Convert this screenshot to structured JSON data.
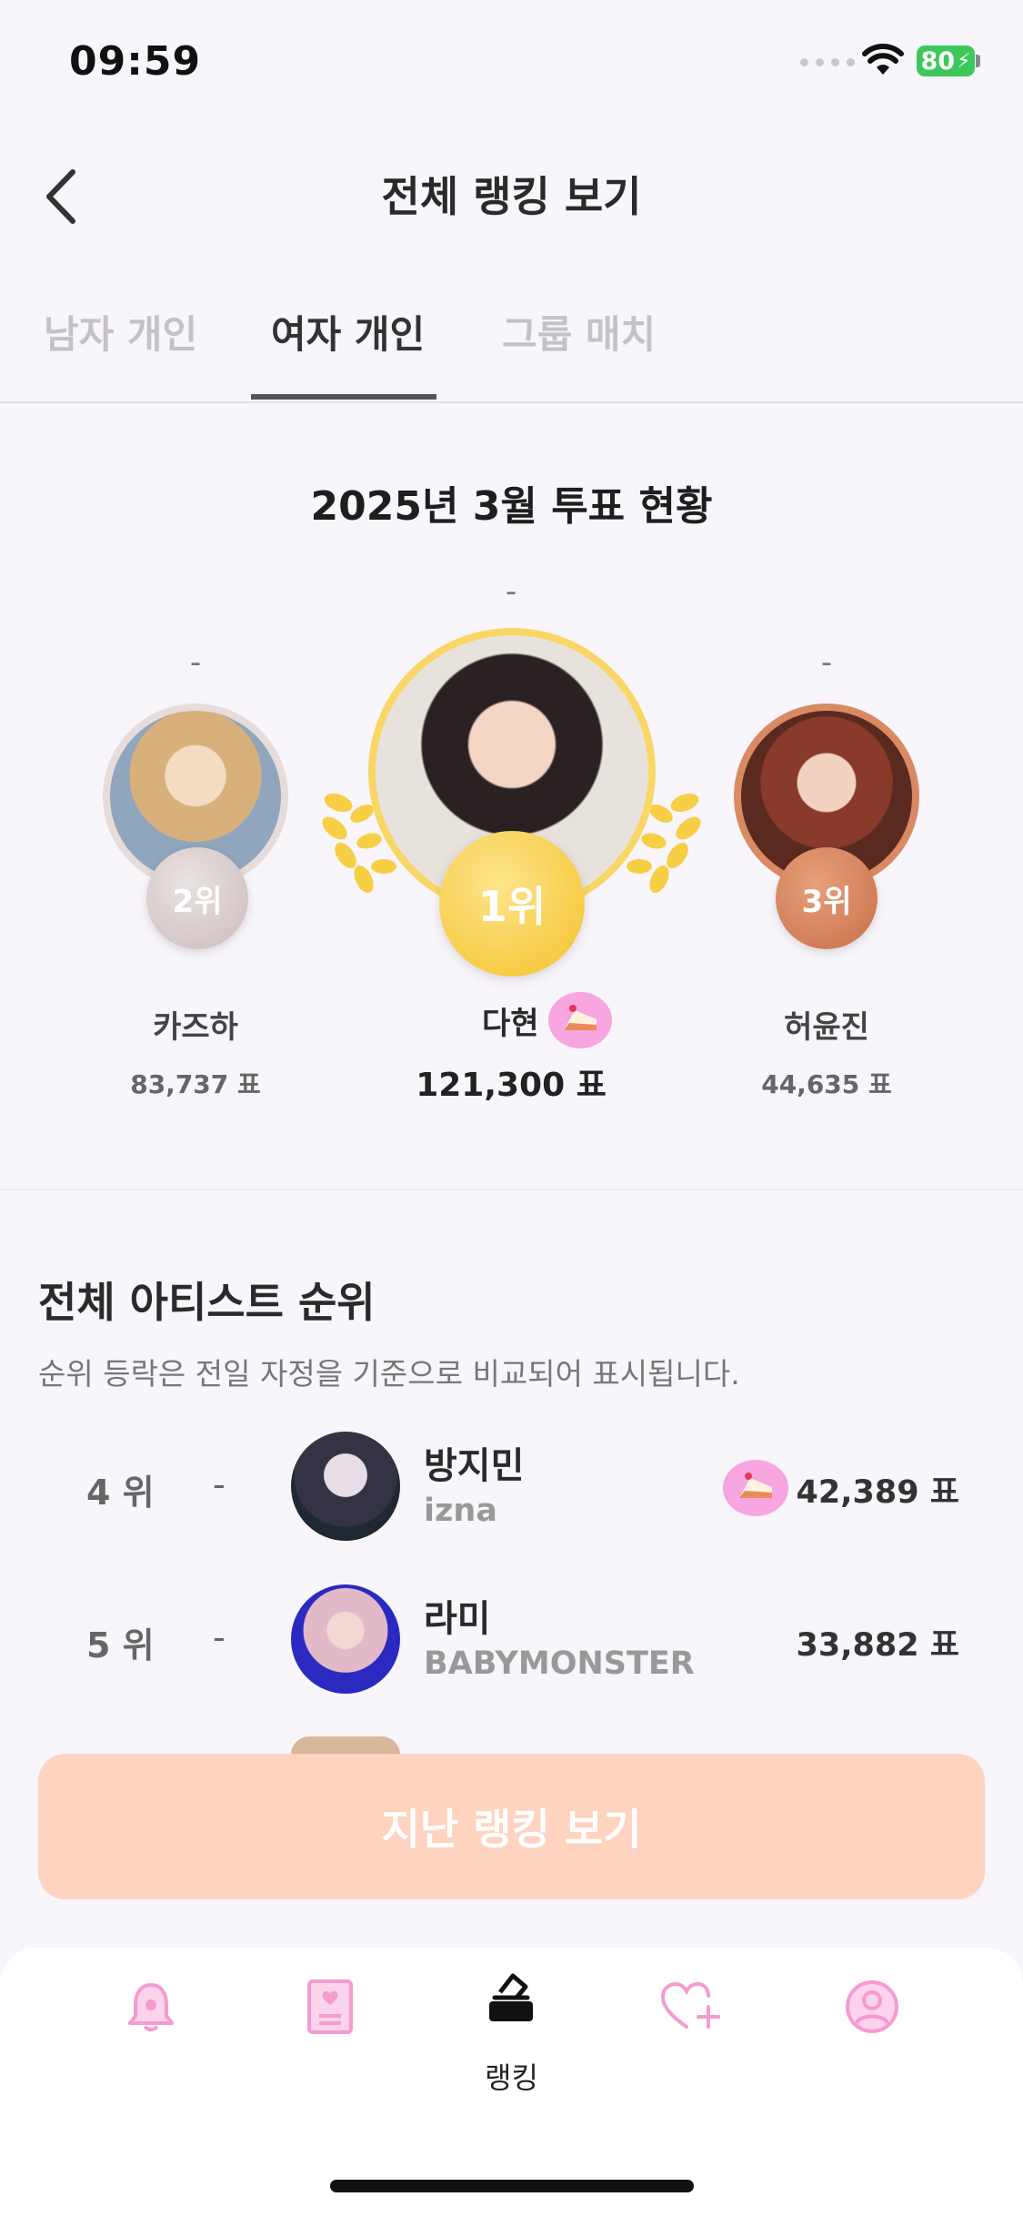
{
  "status_bar": {
    "time": "09:59",
    "battery": "80"
  },
  "header": {
    "title": "전체 랭킹 보기",
    "back_icon": "chevron-left-icon"
  },
  "tabs": [
    {
      "label": "남자 개인",
      "active": false
    },
    {
      "label": "여자 개인",
      "active": true
    },
    {
      "label": "그룹 매치",
      "active": false
    }
  ],
  "podium": {
    "title": "2025년 3월 투표 현황",
    "first": {
      "rank": "1위",
      "change": "-",
      "name": "다현",
      "votes": "121,300 표",
      "birthday": true
    },
    "second": {
      "rank": "2위",
      "change": "-",
      "name": "카즈하",
      "votes": "83,737 표"
    },
    "third": {
      "rank": "3위",
      "change": "-",
      "name": "허윤진",
      "votes": "44,635 표"
    }
  },
  "ranking_list": {
    "title": "전체 아티스트 순위",
    "subtitle": "순위 등락은 전일 자정을 기준으로 비교되어 표시됩니다.",
    "rows": [
      {
        "rank": "4 위",
        "change": "-",
        "name": "방지민",
        "group": "izna",
        "votes": "42,389 표",
        "birthday": true
      },
      {
        "rank": "5 위",
        "change": "-",
        "name": "라미",
        "group": "BABYMONSTER",
        "votes": "33,882 표",
        "birthday": false
      }
    ]
  },
  "past_ranking_button": "지난 랭킹 보기",
  "bottom_nav": {
    "items": [
      {
        "icon": "bell-icon",
        "active": false
      },
      {
        "icon": "photocard-icon",
        "active": false
      },
      {
        "icon": "vote-box-icon",
        "label": "랭킹",
        "active": true
      },
      {
        "icon": "heart-plus-icon",
        "active": false
      },
      {
        "icon": "profile-icon",
        "active": false
      }
    ]
  },
  "colors": {
    "accent_pink": "#f7a6cf",
    "gold": "#f7c83a",
    "silver": "#d8cccc",
    "bronze": "#d6875e",
    "button_peach": "#fed3bf"
  }
}
